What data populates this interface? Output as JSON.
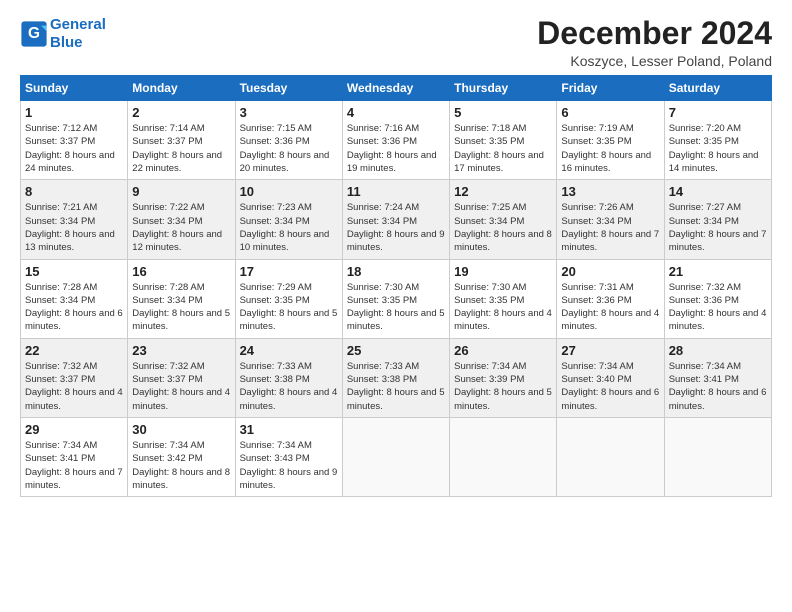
{
  "header": {
    "logo_line1": "General",
    "logo_line2": "Blue",
    "month_title": "December 2024",
    "location": "Koszyce, Lesser Poland, Poland"
  },
  "days_of_week": [
    "Sunday",
    "Monday",
    "Tuesday",
    "Wednesday",
    "Thursday",
    "Friday",
    "Saturday"
  ],
  "weeks": [
    [
      {
        "day": "1",
        "sunrise": "7:12 AM",
        "sunset": "3:37 PM",
        "daylight": "8 hours and 24 minutes."
      },
      {
        "day": "2",
        "sunrise": "7:14 AM",
        "sunset": "3:37 PM",
        "daylight": "8 hours and 22 minutes."
      },
      {
        "day": "3",
        "sunrise": "7:15 AM",
        "sunset": "3:36 PM",
        "daylight": "8 hours and 20 minutes."
      },
      {
        "day": "4",
        "sunrise": "7:16 AM",
        "sunset": "3:36 PM",
        "daylight": "8 hours and 19 minutes."
      },
      {
        "day": "5",
        "sunrise": "7:18 AM",
        "sunset": "3:35 PM",
        "daylight": "8 hours and 17 minutes."
      },
      {
        "day": "6",
        "sunrise": "7:19 AM",
        "sunset": "3:35 PM",
        "daylight": "8 hours and 16 minutes."
      },
      {
        "day": "7",
        "sunrise": "7:20 AM",
        "sunset": "3:35 PM",
        "daylight": "8 hours and 14 minutes."
      }
    ],
    [
      {
        "day": "8",
        "sunrise": "7:21 AM",
        "sunset": "3:34 PM",
        "daylight": "8 hours and 13 minutes."
      },
      {
        "day": "9",
        "sunrise": "7:22 AM",
        "sunset": "3:34 PM",
        "daylight": "8 hours and 12 minutes."
      },
      {
        "day": "10",
        "sunrise": "7:23 AM",
        "sunset": "3:34 PM",
        "daylight": "8 hours and 10 minutes."
      },
      {
        "day": "11",
        "sunrise": "7:24 AM",
        "sunset": "3:34 PM",
        "daylight": "8 hours and 9 minutes."
      },
      {
        "day": "12",
        "sunrise": "7:25 AM",
        "sunset": "3:34 PM",
        "daylight": "8 hours and 8 minutes."
      },
      {
        "day": "13",
        "sunrise": "7:26 AM",
        "sunset": "3:34 PM",
        "daylight": "8 hours and 7 minutes."
      },
      {
        "day": "14",
        "sunrise": "7:27 AM",
        "sunset": "3:34 PM",
        "daylight": "8 hours and 7 minutes."
      }
    ],
    [
      {
        "day": "15",
        "sunrise": "7:28 AM",
        "sunset": "3:34 PM",
        "daylight": "8 hours and 6 minutes."
      },
      {
        "day": "16",
        "sunrise": "7:28 AM",
        "sunset": "3:34 PM",
        "daylight": "8 hours and 5 minutes."
      },
      {
        "day": "17",
        "sunrise": "7:29 AM",
        "sunset": "3:35 PM",
        "daylight": "8 hours and 5 minutes."
      },
      {
        "day": "18",
        "sunrise": "7:30 AM",
        "sunset": "3:35 PM",
        "daylight": "8 hours and 5 minutes."
      },
      {
        "day": "19",
        "sunrise": "7:30 AM",
        "sunset": "3:35 PM",
        "daylight": "8 hours and 4 minutes."
      },
      {
        "day": "20",
        "sunrise": "7:31 AM",
        "sunset": "3:36 PM",
        "daylight": "8 hours and 4 minutes."
      },
      {
        "day": "21",
        "sunrise": "7:32 AM",
        "sunset": "3:36 PM",
        "daylight": "8 hours and 4 minutes."
      }
    ],
    [
      {
        "day": "22",
        "sunrise": "7:32 AM",
        "sunset": "3:37 PM",
        "daylight": "8 hours and 4 minutes."
      },
      {
        "day": "23",
        "sunrise": "7:32 AM",
        "sunset": "3:37 PM",
        "daylight": "8 hours and 4 minutes."
      },
      {
        "day": "24",
        "sunrise": "7:33 AM",
        "sunset": "3:38 PM",
        "daylight": "8 hours and 4 minutes."
      },
      {
        "day": "25",
        "sunrise": "7:33 AM",
        "sunset": "3:38 PM",
        "daylight": "8 hours and 5 minutes."
      },
      {
        "day": "26",
        "sunrise": "7:34 AM",
        "sunset": "3:39 PM",
        "daylight": "8 hours and 5 minutes."
      },
      {
        "day": "27",
        "sunrise": "7:34 AM",
        "sunset": "3:40 PM",
        "daylight": "8 hours and 6 minutes."
      },
      {
        "day": "28",
        "sunrise": "7:34 AM",
        "sunset": "3:41 PM",
        "daylight": "8 hours and 6 minutes."
      }
    ],
    [
      {
        "day": "29",
        "sunrise": "7:34 AM",
        "sunset": "3:41 PM",
        "daylight": "8 hours and 7 minutes."
      },
      {
        "day": "30",
        "sunrise": "7:34 AM",
        "sunset": "3:42 PM",
        "daylight": "8 hours and 8 minutes."
      },
      {
        "day": "31",
        "sunrise": "7:34 AM",
        "sunset": "3:43 PM",
        "daylight": "8 hours and 9 minutes."
      },
      null,
      null,
      null,
      null
    ]
  ],
  "labels": {
    "sunrise": "Sunrise:",
    "sunset": "Sunset:",
    "daylight": "Daylight:"
  }
}
